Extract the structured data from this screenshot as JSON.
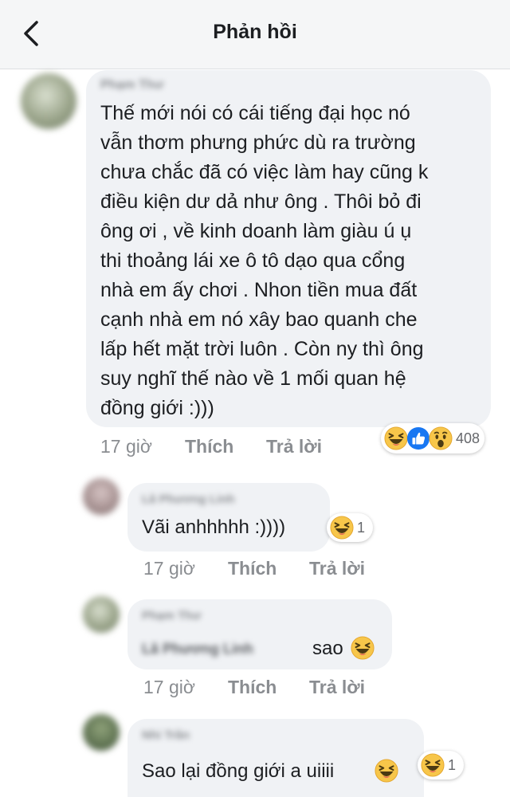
{
  "header": {
    "title": "Phản hồi"
  },
  "comments": [
    {
      "author": "Phạm Thư",
      "lines": [
        "Thế mới nói có cái tiếng đại học nó",
        "vẫn thơm phưng phức dù ra trường",
        "chưa chắc đã có việc làm hay cũng k",
        "điều kiện dư dả như ông . Thôi bỏ đi",
        "ông ơi , về kinh doanh làm giàu ú ụ",
        "thi thoảng lái xe ô tô dạo qua cổng",
        "nhà em ấy chơi . Nhon tiền mua đất",
        "cạnh nhà em nó xây bao quanh che",
        "lấp hết mặt trời luôn . Còn ny thì ông",
        "suy nghĩ thế nào về 1 mối quan hệ",
        "đồng giới :)))"
      ],
      "time": "17 giờ",
      "like": "Thích",
      "reply": "Trả lời",
      "reaction_count": "408",
      "reactions": [
        "haha-icon",
        "like-icon",
        "wow-icon"
      ]
    },
    {
      "author": "Lã Phương Linh",
      "text": "Vãi anhhhhh :))))",
      "time": "17 giờ",
      "like": "Thích",
      "reply": "Trả lời",
      "reaction_count": "1",
      "reactions": [
        "haha-icon"
      ]
    },
    {
      "author": "Phạm Thư",
      "tag": "Lã Phương Linh",
      "text": "sao",
      "time": "17 giờ",
      "like": "Thích",
      "reply": "Trả lời"
    },
    {
      "author": "Nhi Trần",
      "text": "Sao lại đồng giới a uiiii",
      "reaction_count": "1",
      "reactions": [
        "haha-icon"
      ]
    }
  ],
  "colors": {
    "bubble": "#f0f2f5",
    "meta": "#8a8d91",
    "haha": "#f7c64a",
    "like": "#1877f2"
  }
}
